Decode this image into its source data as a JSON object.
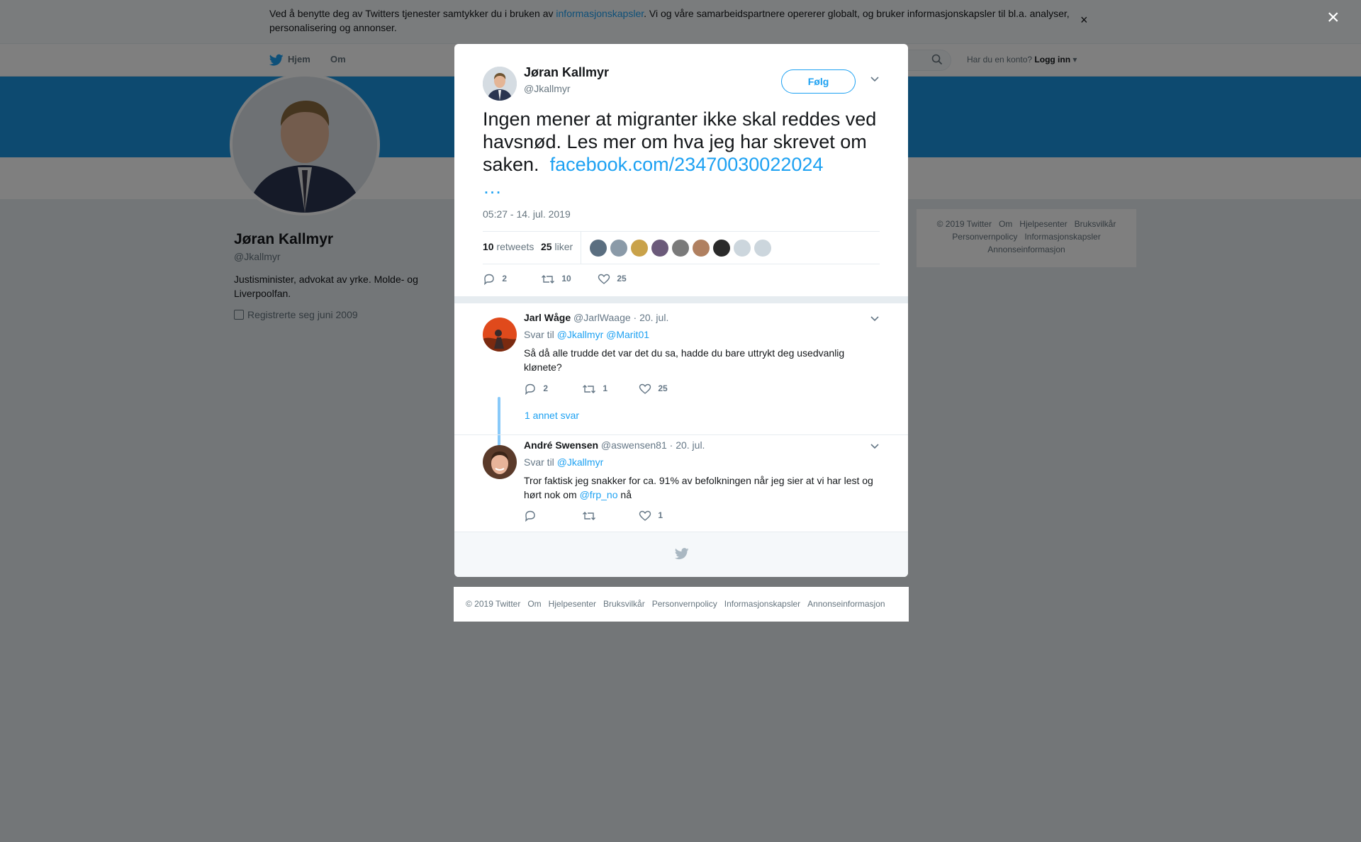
{
  "cookie_banner": {
    "text_before": "Ved å benytte deg av Twitters tjenester samtykker du i bruken av ",
    "link": "informasjonskapsler",
    "text_after": ". Vi og våre samarbeidspartnere opererer globalt, og bruker informasjonskapsler til bl.a. analyser, personalisering og annonser.",
    "close": "×"
  },
  "topnav": {
    "home": "Hjem",
    "about": "Om",
    "account_prompt": "Har du en konto?",
    "login": "Logg inn"
  },
  "profile": {
    "name": "Jøran Kallmyr",
    "handle": "@Jkallmyr",
    "bio": "Justisminister, advokat av yrke. Molde- og Liverpoolfan.",
    "joined": "Registrerte seg juni 2009"
  },
  "side_footer": [
    "© 2019 Twitter",
    "Om",
    "Hjelpesenter",
    "Bruksvilkår",
    "Personvernpolicy",
    "Informasjonskapsler",
    "Annonseinformasjon"
  ],
  "overlay_close": "×",
  "tweet": {
    "name": "Jøran Kallmyr",
    "handle": "@Jkallmyr",
    "follow": "Følg",
    "text": "Ingen mener at migranter ikke skal reddes ved havsnød. Les mer om hva jeg har skrevet om saken.",
    "link": "facebook.com/23470030022024",
    "ellipsis": "…",
    "date": "05:27 - 14. jul. 2019",
    "retweets_count": "10",
    "retweets_label": "retweets",
    "likes_count": "25",
    "likes_label": "liker",
    "replies": "2",
    "retweets": "10",
    "likes": "25",
    "liker_avatar_colors": [
      "#5a6e80",
      "#8a9aa8",
      "#c9a24a",
      "#6b5a7a",
      "#7a7a7a",
      "#b08060",
      "#2a2a2a",
      "#ccd6dd",
      "#ccd6dd"
    ]
  },
  "replies": [
    {
      "name": "Jarl Wåge",
      "handle": "@JarlWaage",
      "date": "· 20. jul.",
      "reply_to_label": "Svar til",
      "reply_to": [
        "@Jkallmyr",
        "@Marit01"
      ],
      "text": "Så då alle trudde det var det du sa, hadde du bare uttrykt deg usedvanlig klønete?",
      "replies": "2",
      "retweets": "1",
      "likes": "25",
      "more": "1 annet svar"
    },
    {
      "name": "André Swensen",
      "handle": "@aswensen81",
      "date": "· 20. jul.",
      "reply_to_label": "Svar til",
      "reply_to": [
        "@Jkallmyr"
      ],
      "text_before": "Tror faktisk jeg snakker for ca. 91% av befolkningen når jeg sier at vi har lest og hørt nok om ",
      "mention": "@frp_no",
      "text_after": " nå",
      "likes": "1"
    }
  ],
  "bottom_footer": [
    "© 2019 Twitter",
    "Om",
    "Hjelpesenter",
    "Bruksvilkår",
    "Personvernpolicy",
    "Informasjonskapsler",
    "Annonseinformasjon"
  ]
}
